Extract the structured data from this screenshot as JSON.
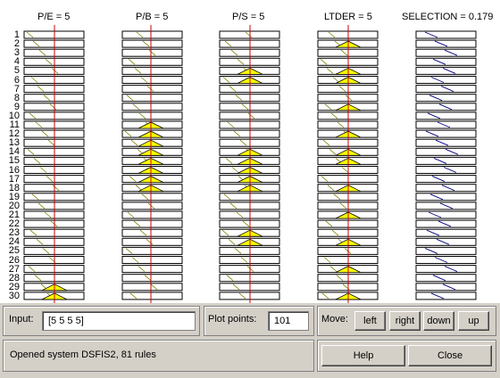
{
  "columns": [
    {
      "title": "P/E = 5"
    },
    {
      "title": "P/B = 5"
    },
    {
      "title": "P/S = 5"
    },
    {
      "title": "LTDER = 5"
    },
    {
      "title": "SELECTION = 0.179"
    }
  ],
  "rule_numbers": [
    "1",
    "2",
    "3",
    "4",
    "5",
    "6",
    "7",
    "8",
    "9",
    "10",
    "11",
    "12",
    "13",
    "14",
    "15",
    "16",
    "17",
    "18",
    "19",
    "20",
    "21",
    "22",
    "23",
    "24",
    "25",
    "26",
    "27",
    "28",
    "29",
    "30"
  ],
  "input_panel": {
    "label": "Input:",
    "value": "[5 5 5 5]"
  },
  "plot_points_panel": {
    "label": "Plot points:",
    "value": "101"
  },
  "move_panel": {
    "label": "Move:",
    "buttons": [
      "left",
      "right",
      "down",
      "up"
    ]
  },
  "status": {
    "text": "Opened system DSFIS2, 81 rules"
  },
  "help_label": "Help",
  "close_label": "Close",
  "colors": {
    "fill": "#ffff00",
    "marker": "#cc0000",
    "output_line": "#000080"
  }
}
